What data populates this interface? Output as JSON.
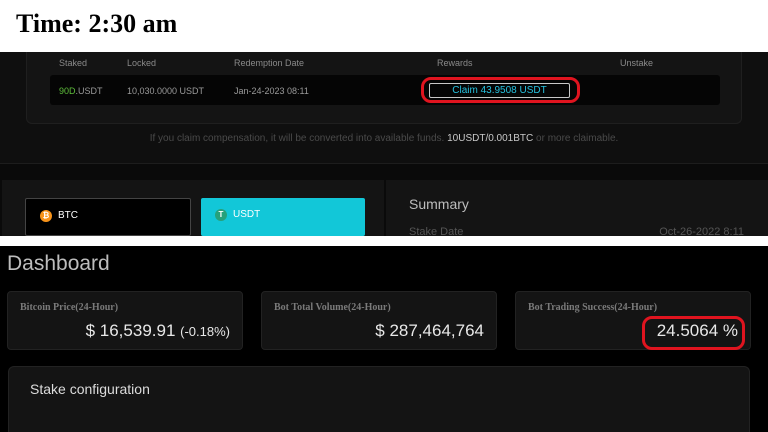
{
  "header": {
    "title": "Time: 2:30 am"
  },
  "stake_table": {
    "columns": [
      "Staked",
      "Locked",
      "Redemption Date",
      "Rewards",
      "Unstake"
    ],
    "row": {
      "staked_term": "90D",
      "staked_coin": ".USDT",
      "locked": "10,030.0000 USDT",
      "redemption_date": "Jan-24-2023 08:11",
      "claim_label": "Claim 43.9508 USDT",
      "unstake": ""
    },
    "note_prefix": "If you claim compensation, it will be converted into available funds.",
    "note_highlight": "10USDT/0.001BTC",
    "note_suffix": "or more claimable."
  },
  "coins": [
    {
      "symbol": "BTC",
      "icon": "bitcoin-icon",
      "color": "#f7931a"
    },
    {
      "symbol": "USDT",
      "icon": "tether-icon",
      "color": "#26a17b"
    }
  ],
  "summary": {
    "title": "Summary",
    "stake_date_label": "Stake Date",
    "stake_date_value": "Oct-26-2022 8:11"
  },
  "dashboard": {
    "title": "Dashboard",
    "cards": [
      {
        "label": "Bitcoin Price(24-Hour)",
        "value": "$ 16,539.91",
        "change": "(-0.18%)"
      },
      {
        "label": "Bot Total Volume(24-Hour)",
        "value": "$ 287,464,764"
      },
      {
        "label": "Bot Trading Success(24-Hour)",
        "value": "24.5064 %"
      }
    ],
    "stake_config_title": "Stake configuration"
  },
  "colors": {
    "accent": "#12c7d8",
    "highlight_ring": "#e0141f",
    "positive": "#5fbf3b"
  }
}
